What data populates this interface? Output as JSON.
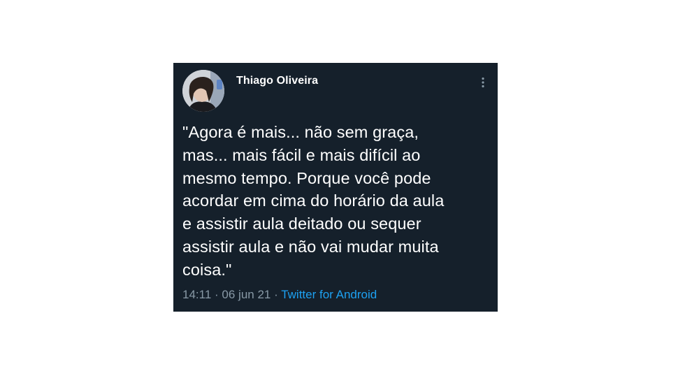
{
  "tweet": {
    "author": "Thiago Oliveira",
    "text": "\"Agora é mais... não sem graça,\nmas... mais fácil e mais difícil ao\nmesmo tempo. Porque você pode\nacordar em cima do horário da aula\ne assistir aula deitado ou sequer\nassistir aula e não vai mudar muita\ncoisa.\"",
    "time": "14:11",
    "separator": "·",
    "date": "06 jun 21",
    "source": "Twitter for Android"
  },
  "icons": {
    "more": "more-vertical-icon",
    "avatar": "avatar"
  },
  "colors": {
    "background": "#15202b",
    "text": "#ffffff",
    "meta": "#8899a6",
    "link": "#1da1f2"
  }
}
